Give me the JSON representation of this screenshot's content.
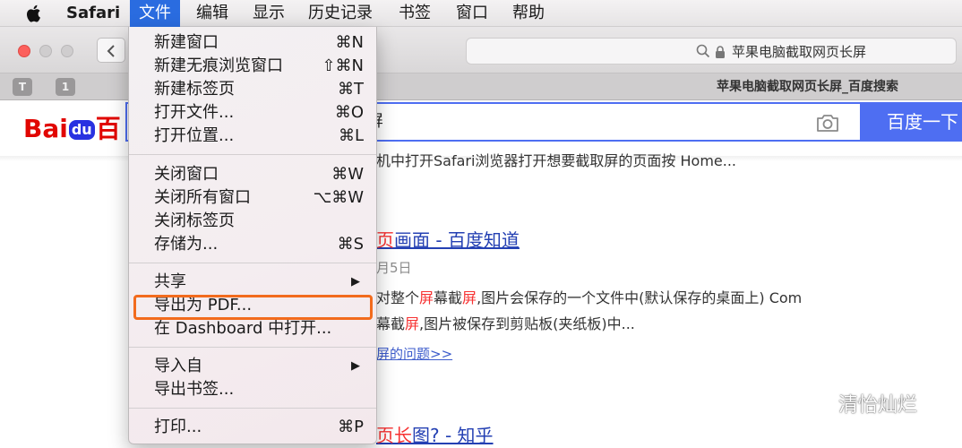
{
  "menubar": {
    "app_name": "Safari",
    "menus": [
      "文件",
      "编辑",
      "显示",
      "历史记录",
      "书签",
      "窗口",
      "帮助"
    ]
  },
  "toolbar": {
    "address_text": "苹果电脑截取网页长屏"
  },
  "tabbar": {
    "badges": [
      "T",
      "1"
    ],
    "tab_title": "苹果电脑截取网页长屏_百度搜索"
  },
  "baidu": {
    "logo_left": "Bai",
    "logo_du": "du",
    "logo_right": "百",
    "query_visible": "屏",
    "search_button": "百度一下"
  },
  "results": {
    "r0_text": "机中打开Safari浏览器打开想要截取屏的页面按 Home...",
    "r1_title_red": "页",
    "r1_title_rest": "画面 - 百度知道",
    "r1_date": "月5日",
    "r1_line1_a": "对整个",
    "r1_line1_b": "屏",
    "r1_line1_c": "幕截",
    "r1_line1_d": "屏",
    "r1_line1_e": ",图片会保存的一个文件中(默认保存的桌面上) Com",
    "r1_line2_a": "幕截",
    "r1_line2_b": "屏",
    "r1_line2_c": ",图片被保存到剪贴板(夹纸板)中...",
    "r1_more": "屏的问题>>",
    "r2_title_red": "页长",
    "r2_title_rest": "图? - 知乎"
  },
  "watermark": "清怡灿烂",
  "file_menu": {
    "items": [
      {
        "label": "新建窗口",
        "shortcut": "⌘N"
      },
      {
        "label": "新建无痕浏览窗口",
        "shortcut": "⇧⌘N"
      },
      {
        "label": "新建标签页",
        "shortcut": "⌘T"
      },
      {
        "label": "打开文件...",
        "shortcut": "⌘O"
      },
      {
        "label": "打开位置...",
        "shortcut": "⌘L"
      },
      {
        "label": "关闭窗口",
        "shortcut": "⌘W"
      },
      {
        "label": "关闭所有窗口",
        "shortcut": "⌥⌘W"
      },
      {
        "label": "关闭标签页",
        "shortcut": ""
      },
      {
        "label": "存储为...",
        "shortcut": "⌘S"
      },
      {
        "label": "共享",
        "shortcut": "▶"
      },
      {
        "label": "导出为 PDF...",
        "shortcut": ""
      },
      {
        "label": "在 Dashboard 中打开...",
        "shortcut": ""
      },
      {
        "label": "导入自",
        "shortcut": "▶"
      },
      {
        "label": "导出书签...",
        "shortcut": ""
      },
      {
        "label": "打印...",
        "shortcut": "⌘P"
      }
    ]
  },
  "colors": {
    "menu_highlight": "#2a6ce0",
    "annotation_box": "#f26b1d",
    "baidu_blue": "#4e6ef2",
    "baidu_red": "#e10602"
  }
}
